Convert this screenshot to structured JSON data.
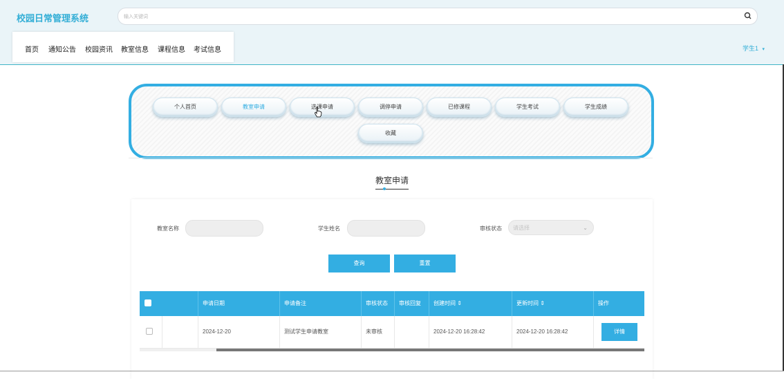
{
  "header": {
    "logo": "校园日常管理系统",
    "search_placeholder": "输入关键词",
    "nav": [
      "首页",
      "通知公告",
      "校园资讯",
      "教室信息",
      "课程信息",
      "考试信息"
    ],
    "user": "学生1",
    "user_caret": "▾"
  },
  "menu": {
    "items": [
      "个人首页",
      "教室申请",
      "选课申请",
      "调停申请",
      "已修课程",
      "学生考试",
      "学生成绩",
      "收藏"
    ],
    "active_index": 1
  },
  "section": {
    "title": "教室申请"
  },
  "filters": {
    "classroom_label": "教室名称",
    "classroom_value": "",
    "student_label": "学生姓名",
    "student_value": "",
    "status_label": "审核状态",
    "status_placeholder": "请选择",
    "query_button": "查询",
    "reset_button": "重置"
  },
  "table": {
    "headers": [
      "申请日期",
      "申请备注",
      "审核状态",
      "审核回复",
      "创建时间 ⇕",
      "更新时间 ⇕",
      "操作"
    ],
    "rows": [
      {
        "date": "2024-12-20",
        "remark": "测试学生申请教室",
        "status": "未审核",
        "reply": "",
        "created": "2024-12-20 16:28:42",
        "updated": "2024-12-20 16:28:42",
        "action": "详情"
      }
    ]
  },
  "icons": {
    "search": "search-icon",
    "caret": "chevron-down-icon",
    "cursor": "hand-cursor-icon"
  },
  "colors": {
    "accent": "#33aee2",
    "header_bg": "#eaf4f8"
  }
}
